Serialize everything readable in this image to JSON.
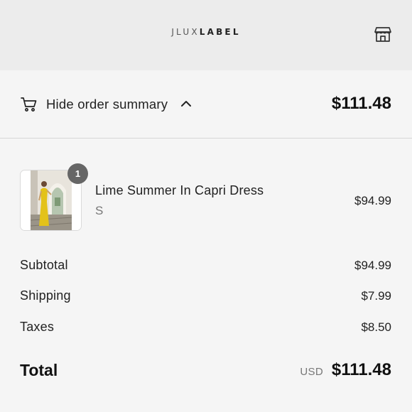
{
  "header": {
    "logo_light": "JLUX",
    "logo_bold": "LABEL",
    "store_icon": "store-icon"
  },
  "summary_bar": {
    "toggle_label": "Hide order summary",
    "cart_icon": "cart-icon",
    "chevron_icon": "chevron-up-icon",
    "total": "$111.48"
  },
  "line_items": [
    {
      "name": "Lime Summer In Capri Dress",
      "variant": "S",
      "quantity": "1",
      "price": "$94.99"
    }
  ],
  "costs": {
    "subtotal_label": "Subtotal",
    "subtotal_value": "$94.99",
    "shipping_label": "Shipping",
    "shipping_value": "$7.99",
    "taxes_label": "Taxes",
    "taxes_value": "$8.50"
  },
  "total": {
    "label": "Total",
    "currency": "USD",
    "value": "$111.48"
  },
  "colors": {
    "header_bg": "#ececec",
    "page_bg": "#f5f5f5",
    "dress": "#e3c21a",
    "badge": "#666666"
  }
}
